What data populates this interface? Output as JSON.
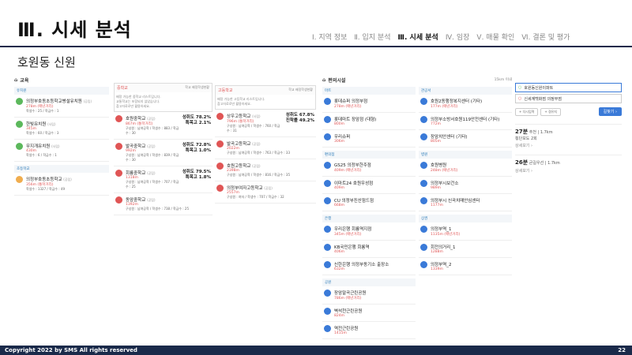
{
  "header": {
    "title": "Ⅲ. 시세 분석",
    "subtitle": "호원동 신원",
    "nav": [
      "Ⅰ. 지역 정보",
      "Ⅱ. 입지 분석",
      "Ⅲ. 시세 분석",
      "Ⅳ. 임장",
      "Ⅴ. 매물 확인",
      "Ⅵ. 결론 및 평가"
    ]
  },
  "footer": {
    "copyright": "Copyright 2022 by SMS All rights reserved",
    "page": "22"
  },
  "edu": {
    "title": "교육",
    "kinder_label": "유치원",
    "kinders": [
      {
        "name": "의정부호동초등학교병설유치원",
        "tag": "(공립)",
        "dist": "278m (매년거리)",
        "meta": "학생수 : 25 / 학급수 : 1"
      },
      {
        "name": "한빛유치원",
        "tag": "(사립)",
        "dist": "345m",
        "meta": "학생수 : 60 / 학급수 : 3"
      },
      {
        "name": "무지개유치원",
        "tag": "(사립)",
        "dist": "430m",
        "meta": "학생수 : 6 / 학급수 : 1"
      }
    ],
    "elem_label": "초등학교",
    "elems": [
      {
        "name": "의정부호동초등학교",
        "tag": "(공립)",
        "dist": "356m (통학거리)",
        "meta": "학생수 : 1327 / 학급수 : 49"
      }
    ]
  },
  "middle": {
    "title": "중학교",
    "hint": "학교 배정학생현황",
    "notice": [
      "배정 가능한 중학교 리스트입니다.",
      "교통학교는 포함되지 않았습니다.",
      "참고자료로만 활용하세요."
    ],
    "schools": [
      {
        "name": "호원중학교",
        "tag": "(공립)",
        "dist": "867m (통학거리)",
        "meta": "구성원 : 남여공학 / 학생수 : 883 / 학급수 : 30",
        "r1": "성취도 78.2%",
        "r2": "특목고 2.1%"
      },
      {
        "name": "발곡중학교",
        "tag": "(공립)",
        "dist": "992m",
        "meta": "구성원 : 남여공학 / 학생수 : 839 / 학급수 : 30",
        "r1": "성취도 72.8%",
        "r2": "특목고 1.0%"
      },
      {
        "name": "회룡중학교",
        "tag": "(공립)",
        "dist": "1318m",
        "meta": "구성원 : 남여공학 / 학생수 : 707 / 학급수 : 25",
        "r1": "성취도 79.5%",
        "r2": "특목고 1.8%"
      },
      {
        "name": "동암중학교",
        "tag": "(공립)",
        "dist": "1392m",
        "meta": "구성원 : 남여공학 / 학생수 : 738 / 학급수 : 25",
        "r1": "",
        "r2": ""
      }
    ]
  },
  "high": {
    "title": "고등학교",
    "hint": "학교 배정학생현황",
    "notice": [
      "배정 가능한 고등학교 리스트입니다.",
      "참고자료로만 활용하세요."
    ],
    "schools": [
      {
        "name": "상우고등학교",
        "tag": "(사립)",
        "dist": "796m (통학거리)",
        "meta": "구성원 : 남여공학 / 학생수 : 760 / 학급수 : 31",
        "r1": "성취도 67.8%",
        "r2": "진학률 49.2%"
      },
      {
        "name": "발곡고등학교",
        "tag": "(공립)",
        "dist": "2022m",
        "meta": "구성원 : 남여공학 / 학생수 : 763 / 학급수 : 33",
        "r1": "",
        "r2": ""
      },
      {
        "name": "호원고등학교",
        "tag": "(공립)",
        "dist": "2398m",
        "meta": "구성원 : 남여공학 / 학생수 : 816 / 학급수 : 35",
        "r1": "",
        "r2": ""
      },
      {
        "name": "의정부여자고등학교",
        "tag": "(공립)",
        "dist": "2557m",
        "meta": "구성원 : 여자 / 학생수 : 707 / 학급수 : 32",
        "r1": "",
        "r2": ""
      }
    ]
  },
  "amenity": {
    "title": "편의시설",
    "range": "15km 이내",
    "left": [
      {
        "sec": "마트",
        "items": [
          {
            "n": "롯데슈퍼 의정부점",
            "d": "278m (매년거리)"
          },
          {
            "n": "롯데마트 장암점 (대형)",
            "d": "800m"
          },
          {
            "n": "우리슈퍼",
            "d": "306m"
          }
        ]
      },
      {
        "sec": "편의점",
        "items": [
          {
            "n": "GS25 의정부한주점",
            "d": "409m (매년거리)"
          },
          {
            "n": "이마트24 호원우성점",
            "d": "409m"
          },
          {
            "n": "CU 의정부진산점드점",
            "d": "668m"
          }
        ]
      },
      {
        "sec": "은행",
        "items": [
          {
            "n": "우리은행 회룡역지점",
            "d": "345m (매년거리)"
          },
          {
            "n": "KB국민은행 회룡역",
            "d": "406m"
          },
          {
            "n": "신한은행 의정부동기소 출장소",
            "d": "632m"
          }
        ]
      },
      {
        "sec": "공원",
        "items": [
          {
            "n": "장암말곡근린공원",
            "d": "786m (매년거리)"
          },
          {
            "n": "벽석천근린공원",
            "d": "824m"
          },
          {
            "n": "역전근린공원",
            "d": "1415m"
          }
        ]
      }
    ],
    "right": [
      {
        "sec": "관공서",
        "items": [
          {
            "n": "호원2동행정복지센터 (기타)",
            "d": "177m (매년거리)"
          },
          {
            "n": "의정부소방서호원119안전센터 (기타)",
            "d": "772m"
          },
          {
            "n": "장암치안센터 (기타)",
            "d": "805m"
          }
        ]
      },
      {
        "sec": "병원",
        "items": [
          {
            "n": "호원병원",
            "d": "248m (매년거리)"
          },
          {
            "n": "의정부시보건소",
            "d": "989m"
          },
          {
            "n": "의정부시 신곡치매안심센터",
            "d": "1177m"
          }
        ]
      },
      {
        "sec": "상권",
        "items": [
          {
            "n": "의정부역_1",
            "d": "1135m (매년거리)"
          },
          {
            "n": "회전의거리_1",
            "d": "1288m"
          },
          {
            "n": "의정부역_2",
            "d": "1339m"
          }
        ]
      }
    ]
  },
  "route": {
    "from": "호원동신원이파트",
    "to": "신세계백화점 의정부점",
    "opt1": "+ 다시입력",
    "opt2": "+ 경유지",
    "btn": "길찾기 ›",
    "r1_time": "27분",
    "r1_mode": "추천",
    "r1_dist": "1.7km",
    "r1_desc": "횡단보도 2회",
    "r1_link": "상세보기 ›",
    "r2_time": "26분",
    "r2_mode": "큰길우선",
    "r2_dist": "1.7km",
    "r2_link": "상세보기 ›"
  }
}
